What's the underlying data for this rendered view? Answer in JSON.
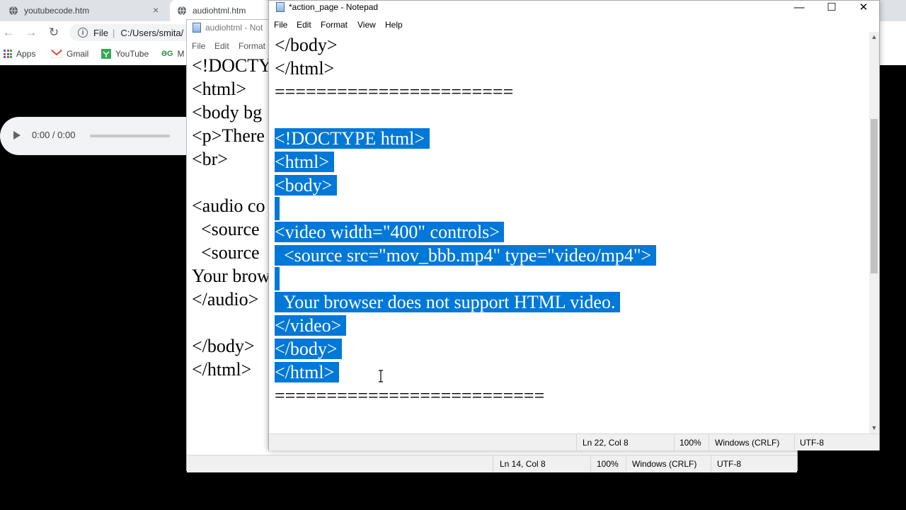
{
  "browser": {
    "tabs": [
      {
        "label": "youtubecode.htm",
        "close": "×"
      },
      {
        "label": "audiohtml.htm"
      }
    ],
    "nav": {
      "back": "←",
      "forward": "→",
      "reload": "↻"
    },
    "address": {
      "scheme": "File",
      "path": "C:/Users/smita/"
    },
    "bookmarks": [
      {
        "label": "Apps",
        "icon": "apps-grid-icon"
      },
      {
        "label": "Gmail",
        "icon": "gmail-icon"
      },
      {
        "label": "YouTube",
        "icon": "youtube-icon"
      },
      {
        "label": "M",
        "icon": "geeksforgeeks-icon"
      }
    ],
    "audio_player": {
      "time": "0:00 / 0:00"
    }
  },
  "notepad_back": {
    "title": "audiohtml - Not",
    "menu": [
      "File",
      "Edit",
      "Format"
    ],
    "content": "<!DOCTY\n<html>\n<body bg\n<p>There\n<br>\n\n<audio co\n  <source\n  <source\nYour brow\n</audio>\n\n</body>\n</html>",
    "status": {
      "position": "Ln 14, Col 8",
      "zoom": "100%",
      "line_ending": "Windows (CRLF)",
      "encoding": "UTF-8"
    }
  },
  "notepad_front": {
    "title": "*action_page - Notepad",
    "caption_buttons": {
      "minimize": "—",
      "maximize": "☐",
      "close": "✕"
    },
    "menu": [
      "File",
      "Edit",
      "Format",
      "View",
      "Help"
    ],
    "lines": [
      {
        "text": "</body>",
        "selected": false
      },
      {
        "text": "</html>",
        "selected": false
      },
      {
        "text": "=======================",
        "selected": false
      },
      {
        "text": "",
        "selected": false
      },
      {
        "text": "<!DOCTYPE html>",
        "selected": true
      },
      {
        "text": "<html>",
        "selected": true
      },
      {
        "text": "<body>",
        "selected": true
      },
      {
        "text": "",
        "selected": true
      },
      {
        "text": "<video width=\"400\" controls>",
        "selected": true
      },
      {
        "text": "  <source src=\"mov_bbb.mp4\" type=\"video/mp4\">",
        "selected": true
      },
      {
        "text": "",
        "selected": true
      },
      {
        "text": "  Your browser does not support HTML video.",
        "selected": true
      },
      {
        "text": "</video>",
        "selected": true
      },
      {
        "text": "</body>",
        "selected": true
      },
      {
        "text": "</html>",
        "selected": true
      },
      {
        "text": "==========================",
        "selected": false
      }
    ],
    "status": {
      "position": "Ln 22, Col 8",
      "zoom": "100%",
      "line_ending": "Windows (CRLF)",
      "encoding": "UTF-8"
    }
  },
  "colors": {
    "selection": "#0078d7",
    "window_bg": "#ffffff",
    "status_bg": "#f0f0f0",
    "desktop": "#000000"
  }
}
